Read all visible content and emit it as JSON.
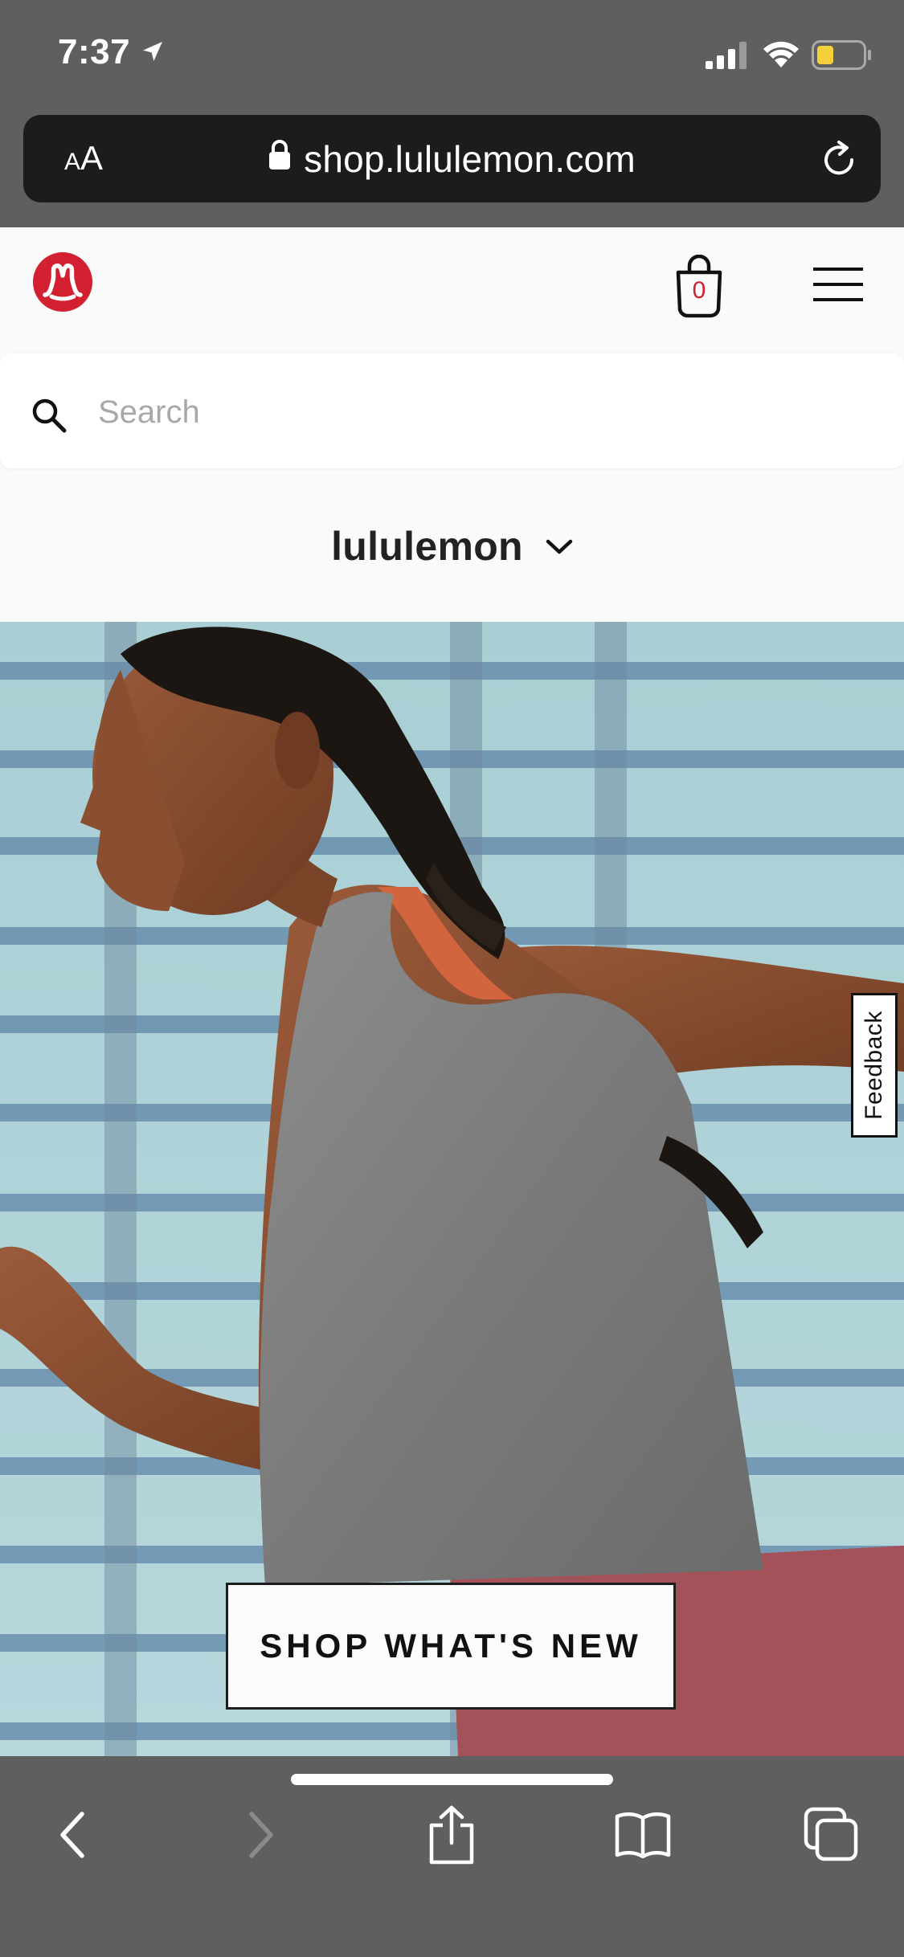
{
  "status_bar": {
    "time": "7:37",
    "icons": [
      "location-arrow-icon",
      "cellular-signal-icon",
      "wifi-icon",
      "battery-icon"
    ]
  },
  "browser": {
    "text_size_small": "A",
    "text_size_large": "A",
    "url": "shop.lululemon.com",
    "toolbar_icons": [
      "back-icon",
      "forward-icon",
      "share-icon",
      "bookmarks-icon",
      "tabs-icon"
    ]
  },
  "header": {
    "bag_count": "0",
    "logo_color": "#d22030"
  },
  "search": {
    "placeholder": "Search"
  },
  "brand_selector": {
    "label": "lululemon"
  },
  "hero": {
    "cta_label": "SHOP WHAT'S NEW"
  },
  "feedback": {
    "label": "Feedback"
  },
  "colors": {
    "browser_chrome": "#5f5f60",
    "address_bar": "#1c1c1e",
    "page_background": "#fafafa",
    "accent_red": "#d22030"
  }
}
